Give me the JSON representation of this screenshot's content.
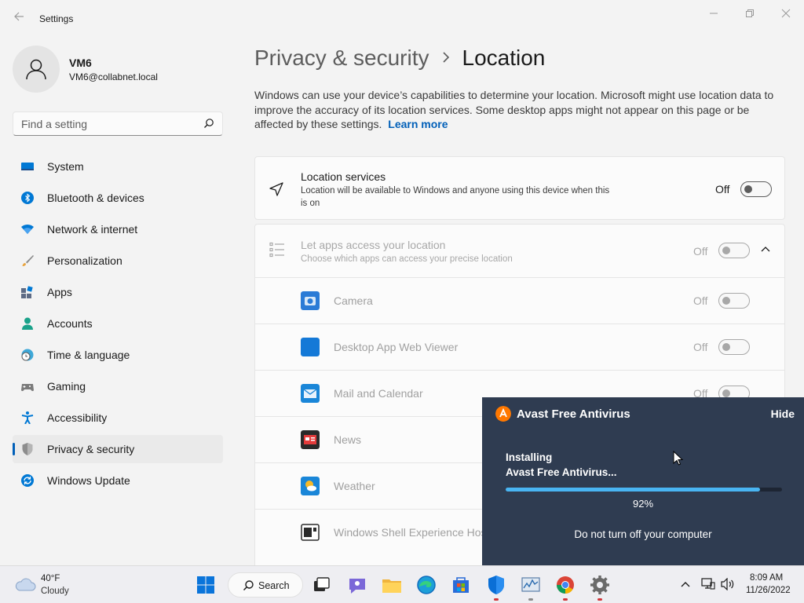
{
  "window": {
    "app_title": "Settings"
  },
  "profile": {
    "name": "VM6",
    "email": "VM6@collabnet.local"
  },
  "search": {
    "placeholder": "Find a setting"
  },
  "nav": {
    "items": [
      {
        "label": "System",
        "icon": "monitor-icon",
        "selected": false
      },
      {
        "label": "Bluetooth & devices",
        "icon": "bluetooth-icon",
        "selected": false
      },
      {
        "label": "Network & internet",
        "icon": "wifi-icon",
        "selected": false
      },
      {
        "label": "Personalization",
        "icon": "brush-icon",
        "selected": false
      },
      {
        "label": "Apps",
        "icon": "apps-icon",
        "selected": false
      },
      {
        "label": "Accounts",
        "icon": "person-icon",
        "selected": false
      },
      {
        "label": "Time & language",
        "icon": "globe-clock-icon",
        "selected": false
      },
      {
        "label": "Gaming",
        "icon": "gamepad-icon",
        "selected": false
      },
      {
        "label": "Accessibility",
        "icon": "accessibility-icon",
        "selected": false
      },
      {
        "label": "Privacy & security",
        "icon": "shield-icon",
        "selected": true
      },
      {
        "label": "Windows Update",
        "icon": "update-icon",
        "selected": false
      }
    ]
  },
  "main": {
    "breadcrumb_parent": "Privacy & security",
    "breadcrumb_current": "Location",
    "description": "Windows can use your device’s capabilities to determine your location. Microsoft might use location data to improve the accuracy of its location services. Some desktop apps might not appear on this page or be affected by these settings.",
    "learn_more": "Learn more",
    "location_services": {
      "title": "Location services",
      "subtitle_line1": "Location will be available to Windows and anyone using this device when this",
      "subtitle_line2": "is on",
      "state": "Off"
    },
    "app_access": {
      "title": "Let apps access your location",
      "subtitle": "Choose which apps can access your precise location",
      "state": "Off"
    },
    "apps": [
      {
        "name": "Camera",
        "state": "Off"
      },
      {
        "name": "Desktop App Web Viewer",
        "state": "Off"
      },
      {
        "name": "Mail and Calendar",
        "state": "Off"
      },
      {
        "name": "News",
        "state": ""
      },
      {
        "name": "Weather",
        "state": ""
      },
      {
        "name": "Windows Shell Experience Hos",
        "state": ""
      }
    ]
  },
  "avast": {
    "title": "Avast Free Antivirus",
    "hide": "Hide",
    "status_line1": "Installing",
    "status_line2": "Avast Free Antivirus...",
    "progress": 0.92,
    "progress_label": "92%",
    "warning": "Do not turn off your computer",
    "accent": "#ff7800",
    "background": "#2f3c51"
  },
  "taskbar": {
    "temperature": "40°F",
    "condition": "Cloudy",
    "search_label": "Search",
    "time": "8:09 AM",
    "date": "11/26/2022"
  },
  "colors": {
    "accent": "#005fb8",
    "background": "#f3f3f3"
  }
}
